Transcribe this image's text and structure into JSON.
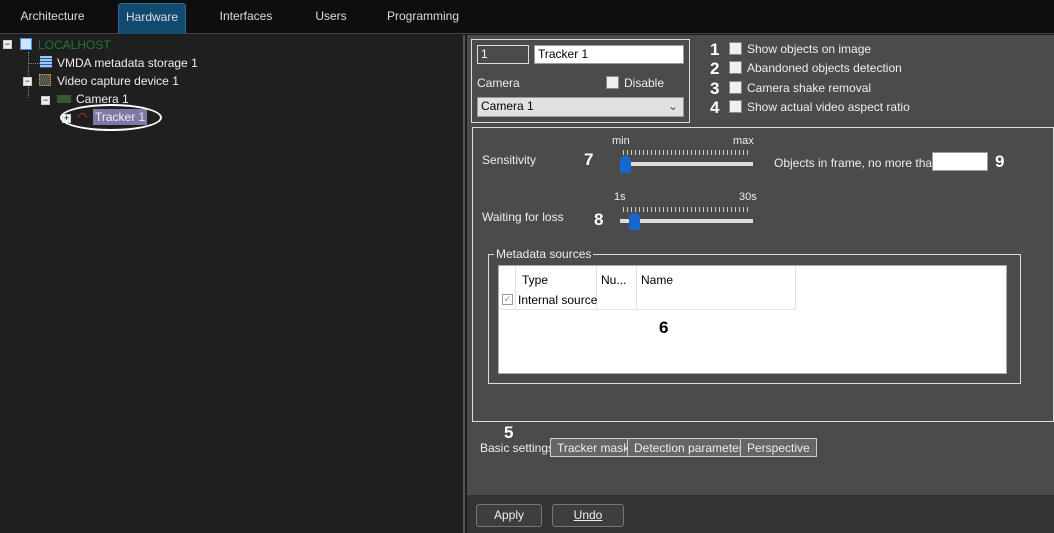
{
  "top_tabs": [
    "Architecture",
    "Hardware",
    "Interfaces",
    "Users",
    "Programming"
  ],
  "tree": {
    "root": "LOCALHOST",
    "storage": "VMDA metadata storage 1",
    "device": "Video capture device 1",
    "camera": "Camera 1",
    "tracker": "Tracker 1"
  },
  "header": {
    "id_value": "1",
    "name_value": "Tracker 1",
    "camera_label": "Camera",
    "disable_label": "Disable",
    "camera_select": "Camera 1"
  },
  "options": [
    {
      "num": "1",
      "label": "Show objects on image",
      "checked": false
    },
    {
      "num": "2",
      "label": "Abandoned objects detection",
      "checked": false
    },
    {
      "num": "3",
      "label": "Camera shake removal",
      "checked": false
    },
    {
      "num": "4",
      "label": "Show actual video aspect ratio",
      "checked": false
    }
  ],
  "sensitivity": {
    "label": "Sensitivity",
    "num": "7",
    "min": "min",
    "max": "max",
    "value_fraction": 0.0
  },
  "waiting": {
    "label": "Waiting for loss",
    "num": "8",
    "min": "1s",
    "max": "30s",
    "value_fraction": 0.07
  },
  "objects": {
    "label": "Objects in frame, no more than",
    "value": "",
    "num": "9"
  },
  "metadata": {
    "title": "Metadata sources",
    "columns": [
      "Type",
      "Nu...",
      "Name"
    ],
    "rows": [
      {
        "checked": true,
        "type": "Internal source",
        "num": "",
        "name": ""
      }
    ],
    "num": "6"
  },
  "bottom_tabs": [
    "Basic settings",
    "Tracker mask",
    "Detection parameters",
    "Perspective"
  ],
  "bottom_tabs_num": "5",
  "buttons": {
    "apply": "Apply",
    "undo": "Undo"
  }
}
